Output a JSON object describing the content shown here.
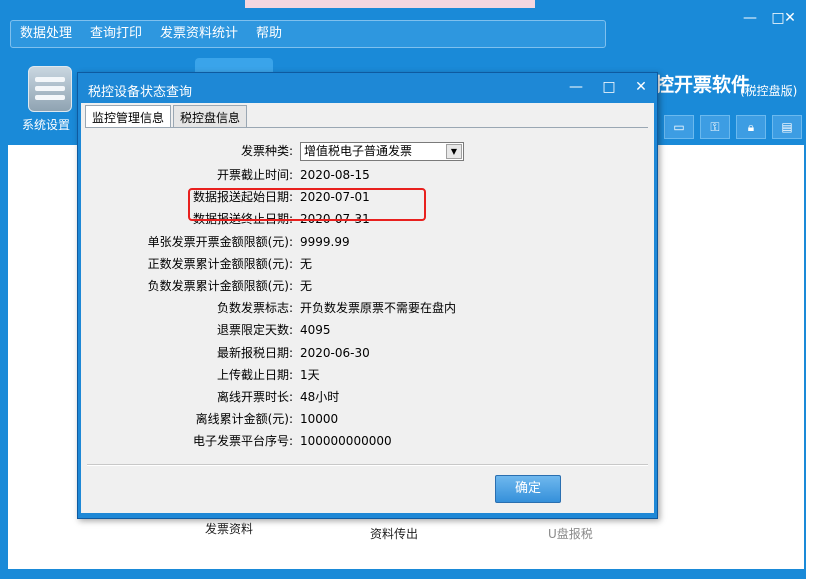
{
  "app": {
    "menu": [
      "数据处理",
      "查询打印",
      "发票资料统计",
      "帮助"
    ],
    "window_controls": [
      "—",
      "□",
      "✕"
    ],
    "toolbar_label": "系统设置",
    "brand_title": "控开票软件",
    "brand_subtitle": "(税控盘版)",
    "toolbar_icons": [
      "window-icon",
      "key-icon",
      "lock-icon",
      "clipboard-icon"
    ],
    "functions": [
      "发票资料",
      "资料传出",
      "U盘报税"
    ]
  },
  "dialog": {
    "title": "税控设备状态查询",
    "controls": [
      "—",
      "□",
      "✕"
    ],
    "tabs": [
      "监控管理信息",
      "税控盘信息"
    ],
    "invoice_type_label": "发票种类:",
    "invoice_type_value": "增值税电子普通发票",
    "fields": [
      {
        "label": "开票截止时间:",
        "value": "2020-08-15"
      },
      {
        "label": "数据报送起始日期:",
        "value": "2020-07-01"
      },
      {
        "label": "数据报送终止日期:",
        "value": "2020-07-31"
      },
      {
        "label": "单张发票开票金额限额(元):",
        "value": "9999.99"
      },
      {
        "label": "正数发票累计金额限额(元):",
        "value": "无"
      },
      {
        "label": "负数发票累计金额限额(元):",
        "value": "无"
      },
      {
        "label": "负数发票标志:",
        "value": "开负数发票原票不需要在盘内"
      },
      {
        "label": "退票限定天数:",
        "value": "4095"
      },
      {
        "label": "最新报税日期:",
        "value": "2020-06-30"
      },
      {
        "label": "上传截止日期:",
        "value": "1天"
      },
      {
        "label": "离线开票时长:",
        "value": "48小时"
      },
      {
        "label": "离线累计金额(元):",
        "value": "10000"
      },
      {
        "label": "电子发票平台序号:",
        "value": "100000000000"
      }
    ],
    "ok_label": "确定",
    "highlight_color": "#e8201e"
  }
}
